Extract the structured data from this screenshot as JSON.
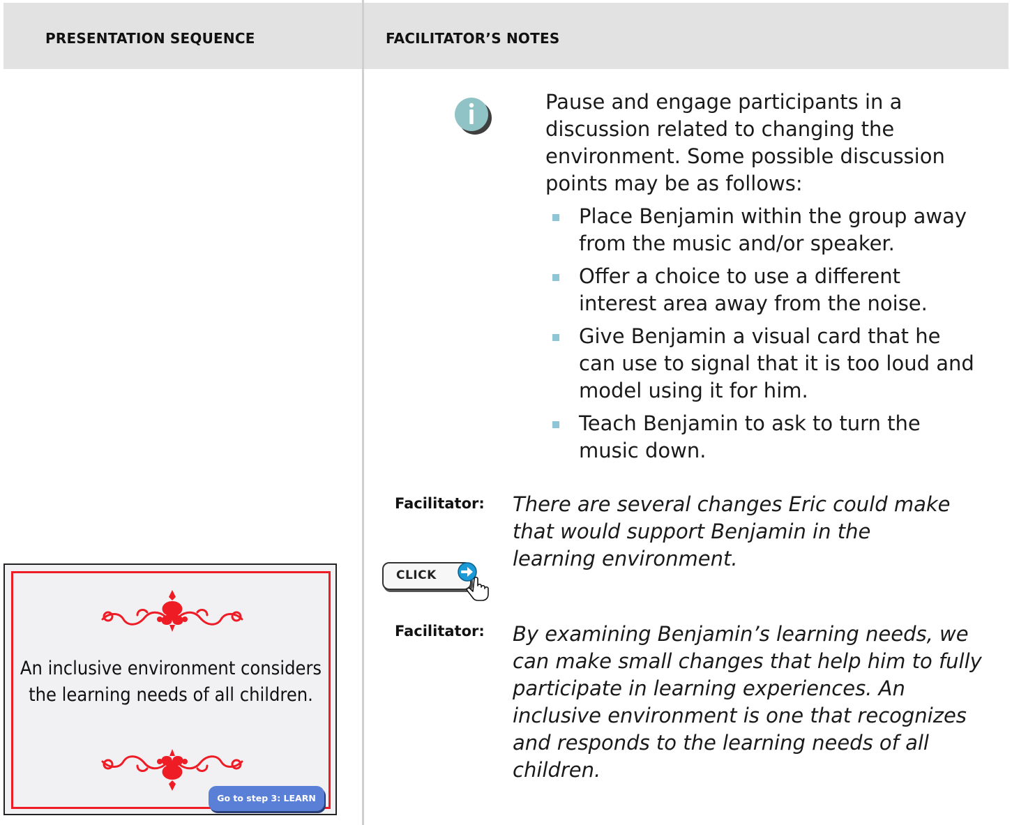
{
  "header": {
    "left_title": "PRESENTATION SEQUENCE",
    "right_title": "FACILITATOR’S NOTES"
  },
  "info": {
    "icon": "info-icon",
    "intro": "Pause and engage participants in a discussion related to changing the environment. Some possible discussion points may be as follows:",
    "bullets": [
      "Place Benjamin within the group away from the music and/or speaker.",
      "Offer a choice to use a different interest area away from the noise.",
      "Give Benjamin a visual card that he can use to signal that it is too loud and model using it for him.",
      "Teach Benjamin to ask to turn the music down."
    ]
  },
  "facilitator_1": {
    "label": "Facilitator:",
    "text": "There are several changes Eric could make that would support Benjamin in the learning environment."
  },
  "click": {
    "label": "CLICK",
    "icon": "hand-pointer-arrow-icon"
  },
  "facilitator_2": {
    "label": "Facilitator:",
    "text": "By examining Benjamin’s learning needs, we can make small changes that help him to fully participate in learning experiences. An inclusive environment is one that recognizes and responds to the learning needs of all children."
  },
  "slide": {
    "text": "An inclusive environment considers the learning needs of all children.",
    "button_label": "Go to step 3: LEARN",
    "ornament": "flourish-ornament-icon"
  },
  "colors": {
    "header_bg": "#e2e2e2",
    "accent_teal": "#8fc3c5",
    "bullet": "#8ec6d8",
    "slide_border": "#ee1c25",
    "slide_button": "#5a7fd6"
  }
}
